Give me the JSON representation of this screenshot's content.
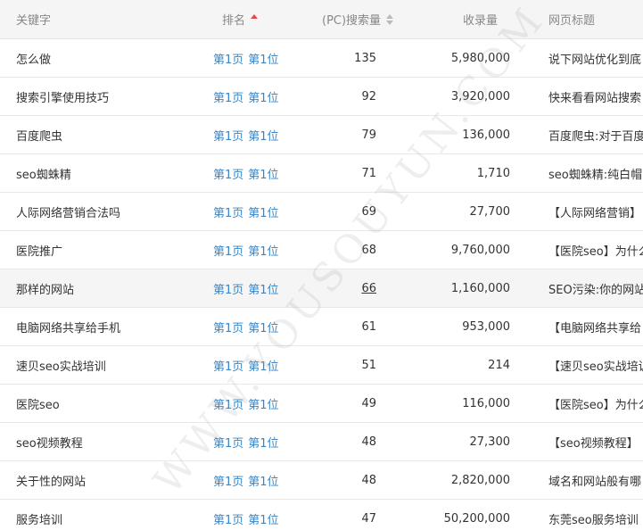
{
  "header": {
    "keyword": "关键字",
    "rank": "排名",
    "volume": "(PC)搜索量",
    "indexed": "收录量",
    "title": "网页标题"
  },
  "watermark": "WWW.YOUSOUYUN.COM",
  "rows": [
    {
      "keyword": "怎么做",
      "page": "第1页",
      "pos": "第1位",
      "volume": "135",
      "indexed": "5,980,000",
      "title": "说下网站优化到底"
    },
    {
      "keyword": "搜索引擎使用技巧",
      "page": "第1页",
      "pos": "第1位",
      "volume": "92",
      "indexed": "3,920,000",
      "title": "快来看看网站搜索"
    },
    {
      "keyword": "百度爬虫",
      "page": "第1页",
      "pos": "第1位",
      "volume": "79",
      "indexed": "136,000",
      "title": "百度爬虫:对于百度"
    },
    {
      "keyword": "seo蜘蛛精",
      "page": "第1页",
      "pos": "第1位",
      "volume": "71",
      "indexed": "1,710",
      "title": "seo蜘蛛精:纯白帽"
    },
    {
      "keyword": "人际网络营销合法吗",
      "page": "第1页",
      "pos": "第1位",
      "volume": "69",
      "indexed": "27,700",
      "title": "【人际网络营销】"
    },
    {
      "keyword": "医院推广",
      "page": "第1页",
      "pos": "第1位",
      "volume": "68",
      "indexed": "9,760,000",
      "title": "【医院seo】为什么"
    },
    {
      "keyword": "那样的网站",
      "page": "第1页",
      "pos": "第1位",
      "volume": "66",
      "indexed": "1,160,000",
      "title": "SEO污染:你的网站"
    },
    {
      "keyword": "电脑网络共享给手机",
      "page": "第1页",
      "pos": "第1位",
      "volume": "61",
      "indexed": "953,000",
      "title": "【电脑网络共享给"
    },
    {
      "keyword": "速贝seo实战培训",
      "page": "第1页",
      "pos": "第1位",
      "volume": "51",
      "indexed": "214",
      "title": "【速贝seo实战培训"
    },
    {
      "keyword": "医院seo",
      "page": "第1页",
      "pos": "第1位",
      "volume": "49",
      "indexed": "116,000",
      "title": "【医院seo】为什么"
    },
    {
      "keyword": "seo视频教程",
      "page": "第1页",
      "pos": "第1位",
      "volume": "48",
      "indexed": "27,300",
      "title": "【seo视频教程】"
    },
    {
      "keyword": "关于性的网站",
      "page": "第1页",
      "pos": "第1位",
      "volume": "48",
      "indexed": "2,820,000",
      "title": "域名和网站般有哪"
    },
    {
      "keyword": "服务培训",
      "page": "第1页",
      "pos": "第1位",
      "volume": "47",
      "indexed": "50,200,000",
      "title": "东莞seo服务培训"
    }
  ]
}
